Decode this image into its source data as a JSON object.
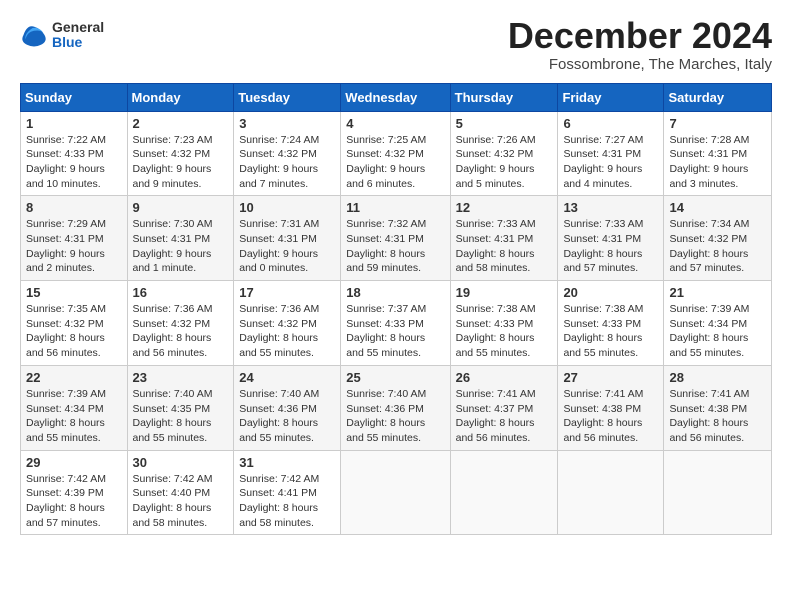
{
  "header": {
    "logo_general": "General",
    "logo_blue": "Blue",
    "month_title": "December 2024",
    "location": "Fossombrone, The Marches, Italy"
  },
  "columns": [
    "Sunday",
    "Monday",
    "Tuesday",
    "Wednesday",
    "Thursday",
    "Friday",
    "Saturday"
  ],
  "weeks": [
    [
      {
        "day": "1",
        "sunrise": "7:22 AM",
        "sunset": "4:33 PM",
        "daylight": "9 hours and 10 minutes."
      },
      {
        "day": "2",
        "sunrise": "7:23 AM",
        "sunset": "4:32 PM",
        "daylight": "9 hours and 9 minutes."
      },
      {
        "day": "3",
        "sunrise": "7:24 AM",
        "sunset": "4:32 PM",
        "daylight": "9 hours and 7 minutes."
      },
      {
        "day": "4",
        "sunrise": "7:25 AM",
        "sunset": "4:32 PM",
        "daylight": "9 hours and 6 minutes."
      },
      {
        "day": "5",
        "sunrise": "7:26 AM",
        "sunset": "4:32 PM",
        "daylight": "9 hours and 5 minutes."
      },
      {
        "day": "6",
        "sunrise": "7:27 AM",
        "sunset": "4:31 PM",
        "daylight": "9 hours and 4 minutes."
      },
      {
        "day": "7",
        "sunrise": "7:28 AM",
        "sunset": "4:31 PM",
        "daylight": "9 hours and 3 minutes."
      }
    ],
    [
      {
        "day": "8",
        "sunrise": "7:29 AM",
        "sunset": "4:31 PM",
        "daylight": "9 hours and 2 minutes."
      },
      {
        "day": "9",
        "sunrise": "7:30 AM",
        "sunset": "4:31 PM",
        "daylight": "9 hours and 1 minute."
      },
      {
        "day": "10",
        "sunrise": "7:31 AM",
        "sunset": "4:31 PM",
        "daylight": "9 hours and 0 minutes."
      },
      {
        "day": "11",
        "sunrise": "7:32 AM",
        "sunset": "4:31 PM",
        "daylight": "8 hours and 59 minutes."
      },
      {
        "day": "12",
        "sunrise": "7:33 AM",
        "sunset": "4:31 PM",
        "daylight": "8 hours and 58 minutes."
      },
      {
        "day": "13",
        "sunrise": "7:33 AM",
        "sunset": "4:31 PM",
        "daylight": "8 hours and 57 minutes."
      },
      {
        "day": "14",
        "sunrise": "7:34 AM",
        "sunset": "4:32 PM",
        "daylight": "8 hours and 57 minutes."
      }
    ],
    [
      {
        "day": "15",
        "sunrise": "7:35 AM",
        "sunset": "4:32 PM",
        "daylight": "8 hours and 56 minutes."
      },
      {
        "day": "16",
        "sunrise": "7:36 AM",
        "sunset": "4:32 PM",
        "daylight": "8 hours and 56 minutes."
      },
      {
        "day": "17",
        "sunrise": "7:36 AM",
        "sunset": "4:32 PM",
        "daylight": "8 hours and 55 minutes."
      },
      {
        "day": "18",
        "sunrise": "7:37 AM",
        "sunset": "4:33 PM",
        "daylight": "8 hours and 55 minutes."
      },
      {
        "day": "19",
        "sunrise": "7:38 AM",
        "sunset": "4:33 PM",
        "daylight": "8 hours and 55 minutes."
      },
      {
        "day": "20",
        "sunrise": "7:38 AM",
        "sunset": "4:33 PM",
        "daylight": "8 hours and 55 minutes."
      },
      {
        "day": "21",
        "sunrise": "7:39 AM",
        "sunset": "4:34 PM",
        "daylight": "8 hours and 55 minutes."
      }
    ],
    [
      {
        "day": "22",
        "sunrise": "7:39 AM",
        "sunset": "4:34 PM",
        "daylight": "8 hours and 55 minutes."
      },
      {
        "day": "23",
        "sunrise": "7:40 AM",
        "sunset": "4:35 PM",
        "daylight": "8 hours and 55 minutes."
      },
      {
        "day": "24",
        "sunrise": "7:40 AM",
        "sunset": "4:36 PM",
        "daylight": "8 hours and 55 minutes."
      },
      {
        "day": "25",
        "sunrise": "7:40 AM",
        "sunset": "4:36 PM",
        "daylight": "8 hours and 55 minutes."
      },
      {
        "day": "26",
        "sunrise": "7:41 AM",
        "sunset": "4:37 PM",
        "daylight": "8 hours and 56 minutes."
      },
      {
        "day": "27",
        "sunrise": "7:41 AM",
        "sunset": "4:38 PM",
        "daylight": "8 hours and 56 minutes."
      },
      {
        "day": "28",
        "sunrise": "7:41 AM",
        "sunset": "4:38 PM",
        "daylight": "8 hours and 56 minutes."
      }
    ],
    [
      {
        "day": "29",
        "sunrise": "7:42 AM",
        "sunset": "4:39 PM",
        "daylight": "8 hours and 57 minutes."
      },
      {
        "day": "30",
        "sunrise": "7:42 AM",
        "sunset": "4:40 PM",
        "daylight": "8 hours and 58 minutes."
      },
      {
        "day": "31",
        "sunrise": "7:42 AM",
        "sunset": "4:41 PM",
        "daylight": "8 hours and 58 minutes."
      },
      null,
      null,
      null,
      null
    ]
  ],
  "labels": {
    "sunrise": "Sunrise:",
    "sunset": "Sunset:",
    "daylight": "Daylight:"
  }
}
